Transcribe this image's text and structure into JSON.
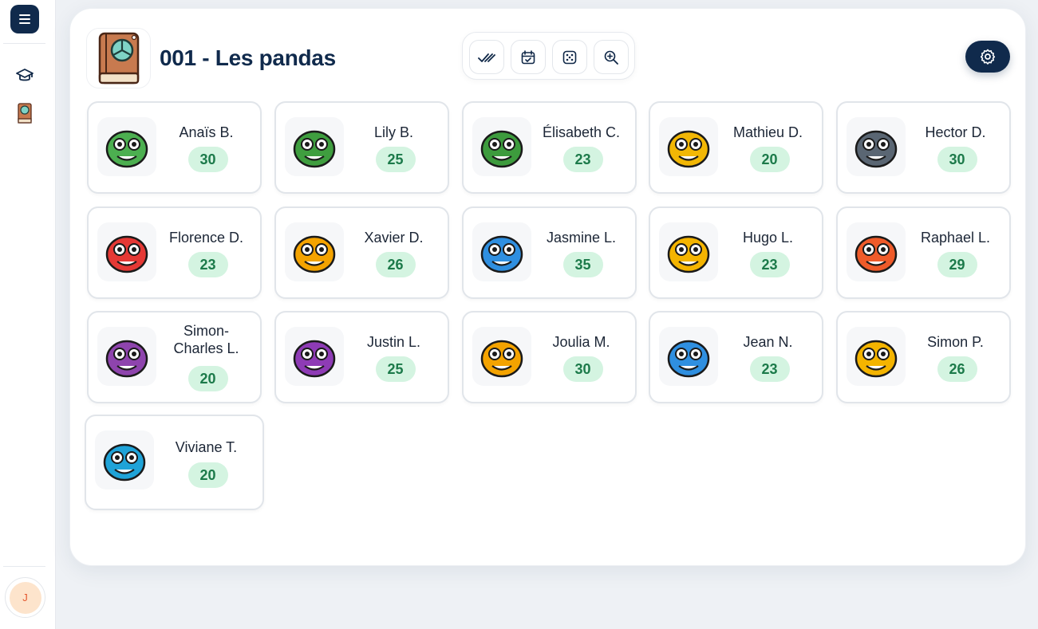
{
  "sidebar": {
    "icons": [
      "menu-icon",
      "graduation-cap-icon",
      "book-icon"
    ],
    "user_initial": "J"
  },
  "header": {
    "class_title": "001 - Les pandas",
    "toolbar": [
      "double-check-icon",
      "calendar-check-icon",
      "dice-icon",
      "zoom-in-icon"
    ],
    "settings_icon": "gear-icon"
  },
  "students": [
    {
      "name": "Anaïs B.",
      "score": "30",
      "color": "#4caf50"
    },
    {
      "name": "Lily B.",
      "score": "25",
      "color": "#3f9e3f"
    },
    {
      "name": "Élisabeth C.",
      "score": "23",
      "color": "#3d9b3d"
    },
    {
      "name": "Mathieu D.",
      "score": "20",
      "color": "#f2b705"
    },
    {
      "name": "Hector D.",
      "score": "30",
      "color": "#5a6673"
    },
    {
      "name": "Florence D.",
      "score": "23",
      "color": "#e53935"
    },
    {
      "name": "Xavier D.",
      "score": "26",
      "color": "#f4a300"
    },
    {
      "name": "Jasmine L.",
      "score": "35",
      "color": "#2f8fe0"
    },
    {
      "name": "Hugo L.",
      "score": "23",
      "color": "#f4b400"
    },
    {
      "name": "Raphael L.",
      "score": "29",
      "color": "#ef5b2a"
    },
    {
      "name": "Simon-Charles L.",
      "score": "20",
      "color": "#8e44ad"
    },
    {
      "name": "Justin L.",
      "score": "25",
      "color": "#8e3bb5"
    },
    {
      "name": "Joulia M.",
      "score": "30",
      "color": "#f4a300"
    },
    {
      "name": "Jean N.",
      "score": "23",
      "color": "#2f8fe0"
    },
    {
      "name": "Simon P.",
      "score": "26",
      "color": "#f4b400"
    },
    {
      "name": "Viviane T.",
      "score": "20",
      "color": "#1fa3d8"
    }
  ]
}
